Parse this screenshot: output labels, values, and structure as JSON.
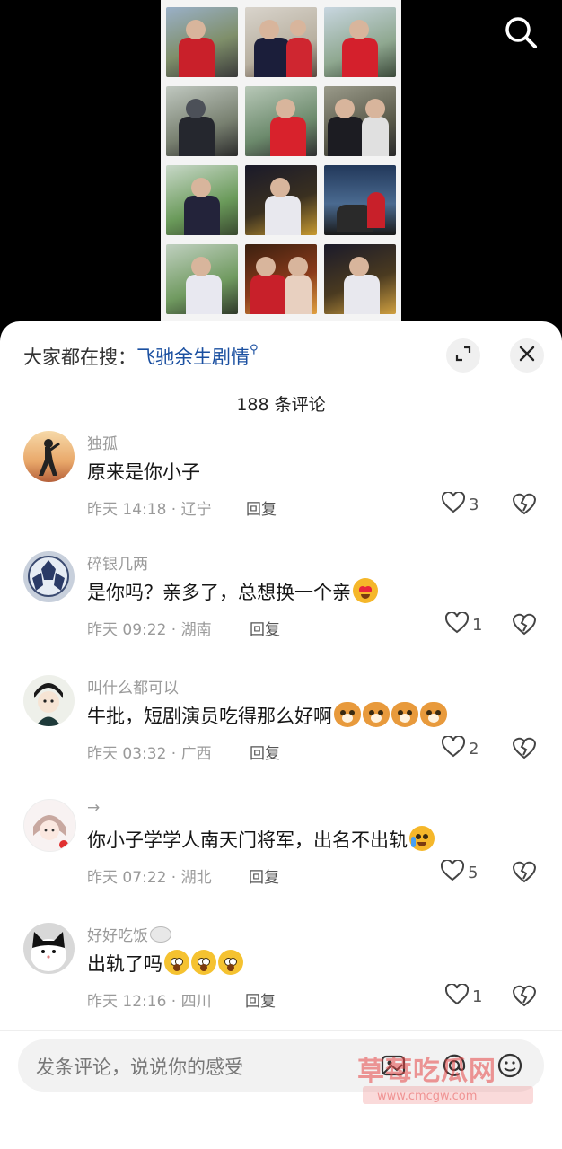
{
  "video": {
    "collage_tiles": 12,
    "search_icon": "search-icon"
  },
  "sheet": {
    "search_prefix": "大家都在搜：",
    "search_keyword": "飞驰余生剧情",
    "expand_icon": "expand-icon",
    "close_icon": "close-icon",
    "comment_count": "188 条评论"
  },
  "comments": [
    {
      "user": "独孤",
      "text": "原来是你小子",
      "emoji": [],
      "meta": "昨天 14:18 · 辽宁",
      "reply": "回复",
      "likes": "3"
    },
    {
      "user": "碎银几两",
      "text": "是你吗？亲多了，总想换一个亲",
      "emoji": [
        "heart-eyes"
      ],
      "meta": "昨天 09:22 · 湖南",
      "reply": "回复",
      "likes": "1"
    },
    {
      "user": "叫什么都可以",
      "text": "牛批，短剧演员吃得那么好啊",
      "emoji": [
        "dog",
        "dog",
        "dog",
        "dog"
      ],
      "meta": "昨天 03:32 · 广西",
      "reply": "回复",
      "likes": "2"
    },
    {
      "user": "→",
      "text": "你小子学学人南天门将军，出名不出轨",
      "emoji": [
        "laugh-cry"
      ],
      "meta": "昨天 07:22 · 湖北",
      "reply": "回复",
      "likes": "5"
    },
    {
      "user": "好好吃饭",
      "text": "出轨了吗",
      "emoji": [
        "flushed",
        "flushed",
        "flushed"
      ],
      "meta": "昨天 12:16 · 四川",
      "reply": "回复",
      "likes": "1"
    }
  ],
  "input": {
    "placeholder": "发条评论，说说你的感受"
  },
  "watermark": {
    "text": "草莓吃瓜网",
    "sub": "www.cmcgw.com"
  },
  "colors": {
    "keyword": "#1a4fa0",
    "meta_gray": "#9a9a9a",
    "text": "#161616",
    "sheet_bg": "#ffffff",
    "video_bg": "#000000"
  }
}
